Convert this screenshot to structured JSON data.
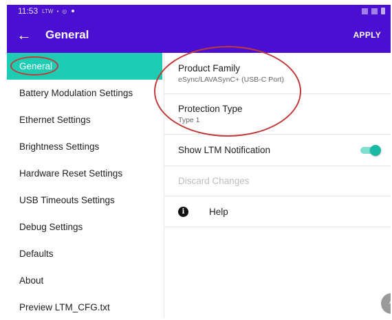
{
  "status_bar": {
    "time": "11:53",
    "indicators": "LTW",
    "icons": [
      "image-icon",
      "sync-icon",
      "notification-dot-icon"
    ],
    "right_icons": [
      "no-signal-icon",
      "wifi-icon",
      "battery-icon"
    ]
  },
  "app_bar": {
    "back_icon": "arrow-left-icon",
    "back_glyph": "←",
    "title": "General",
    "action": "APPLY",
    "color": "#4a0fd0"
  },
  "sidebar": {
    "active_color": "#1ecbb3",
    "items": [
      {
        "label": "General",
        "active": true
      },
      {
        "label": "Battery Modulation Settings"
      },
      {
        "label": "Ethernet Settings"
      },
      {
        "label": "Brightness Settings"
      },
      {
        "label": "Hardware Reset Settings"
      },
      {
        "label": "USB Timeouts Settings"
      },
      {
        "label": "Debug Settings"
      },
      {
        "label": "Defaults"
      },
      {
        "label": "About"
      },
      {
        "label": "Preview LTM_CFG.txt"
      }
    ]
  },
  "main": {
    "product_family": {
      "title": "Product Family",
      "value": "eSync/LAVASynC+ (USB-C Port)"
    },
    "protection_type": {
      "title": "Protection Type",
      "value": "Type 1"
    },
    "ltm_notification": {
      "label": "Show LTM Notification",
      "enabled": true
    },
    "discard": {
      "label": "Discard Changes",
      "enabled": false
    },
    "help": {
      "label": "Help",
      "icon": "info-icon",
      "glyph": "i"
    }
  },
  "fab": {
    "icon": "chevron-up-icon",
    "glyph": "^"
  }
}
